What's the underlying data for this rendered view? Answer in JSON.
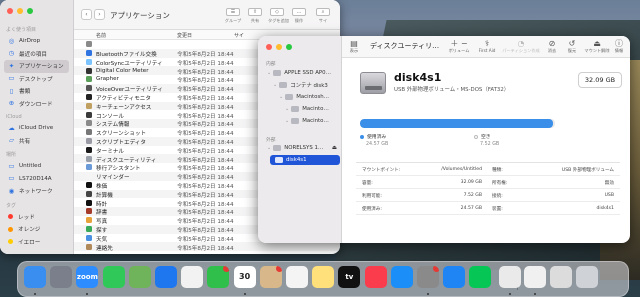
{
  "finder": {
    "title": "アプリケーション",
    "toolbar": {
      "group_label": "グループ",
      "share_label": "共有",
      "tags_label": "タグを追加",
      "action_label": "操作",
      "search_label": "サイ"
    },
    "columns": {
      "name": "名前",
      "date": "変更日",
      "size": "サイ"
    },
    "sidebar": {
      "favorites_heading": "よく使う項目",
      "favorites": [
        {
          "label": "AirDrop",
          "icon": "airdrop-icon"
        },
        {
          "label": "最近の項目",
          "icon": "clock-icon"
        },
        {
          "label": "アプリケーション",
          "icon": "apps-icon",
          "active": true
        },
        {
          "label": "デスクトップ",
          "icon": "desktop-icon"
        },
        {
          "label": "書類",
          "icon": "document-icon"
        },
        {
          "label": "ダウンロード",
          "icon": "download-icon"
        }
      ],
      "icloud_heading": "iCloud",
      "icloud": [
        {
          "label": "iCloud Drive",
          "icon": "cloud-icon"
        },
        {
          "label": "共有",
          "icon": "shared-folder-icon"
        }
      ],
      "locations_heading": "場所",
      "locations": [
        {
          "label": "Untitled",
          "icon": "drive-icon"
        },
        {
          "label": "LS720D14A",
          "icon": "monitor-icon"
        },
        {
          "label": "ネットワーク",
          "icon": "network-icon"
        }
      ],
      "tags_heading": "タグ",
      "tags": [
        {
          "label": "レッド",
          "color": "#ff3b30"
        },
        {
          "label": "オレンジ",
          "color": "#ff9500"
        },
        {
          "label": "イエロー",
          "color": "#ffcc00"
        }
      ]
    },
    "rows": [
      {
        "name": "",
        "date": "",
        "color": "#8a8a8a"
      },
      {
        "name": "Bluetoothファイル交換",
        "date": "令和5年8月2日 18:44",
        "color": "#2f74e0"
      },
      {
        "name": "ColorSyncユーティリティ",
        "date": "令和5年8月2日 18:44",
        "color": "#7cc4ff"
      },
      {
        "name": "Digital Color Meter",
        "date": "令和5年8月2日 18:44",
        "color": "#333333"
      },
      {
        "name": "Grapher",
        "date": "令和5年8月2日 18:44",
        "color": "#5aa05a"
      },
      {
        "name": "VoiceOverユーティリティ",
        "date": "令和5年8月2日 18:44",
        "color": "#555555"
      },
      {
        "name": "アクティビティモニタ",
        "date": "令和5年8月2日 18:44",
        "color": "#222222"
      },
      {
        "name": "キーチェーンアクセス",
        "date": "令和5年8月2日 18:44",
        "color": "#c0a060"
      },
      {
        "name": "コンソール",
        "date": "令和5年8月2日 18:44",
        "color": "#3b3b3b"
      },
      {
        "name": "システム情報",
        "date": "令和5年8月2日 18:44",
        "color": "#8a8a8a"
      },
      {
        "name": "スクリーンショット",
        "date": "令和5年8月2日 18:44",
        "color": "#777777"
      },
      {
        "name": "スクリプトエディタ",
        "date": "令和5年8月2日 18:44",
        "color": "#9a9aa5"
      },
      {
        "name": "ターミナル",
        "date": "令和5年8月2日 18:44",
        "color": "#1a1a1a"
      },
      {
        "name": "ディスクユーティリティ",
        "date": "令和5年8月2日 18:44",
        "color": "#9aa0aa"
      },
      {
        "name": "移行アシスタント",
        "date": "令和5年8月2日 18:44",
        "color": "#6a9ad8"
      },
      {
        "name": "リマインダー",
        "date": "令和5年8月2日 18:44",
        "color": "#f5f5f5"
      },
      {
        "name": "株価",
        "date": "令和5年8月2日 18:44",
        "color": "#111111"
      },
      {
        "name": "計算機",
        "date": "令和5年8月2日 18:44",
        "color": "#444444"
      },
      {
        "name": "時計",
        "date": "令和5年8月2日 18:44",
        "color": "#111111"
      },
      {
        "name": "辞書",
        "date": "令和5年8月2日 18:44",
        "color": "#a33a2a"
      },
      {
        "name": "写真",
        "date": "令和5年8月2日 18:44",
        "color": "#e8a23a"
      },
      {
        "name": "探す",
        "date": "令和5年8月2日 18:44",
        "color": "#3aaa5a"
      },
      {
        "name": "天気",
        "date": "令和5年8月2日 18:44",
        "color": "#4a90e2"
      },
      {
        "name": "連絡先",
        "date": "令和5年8月2日 18:44",
        "color": "#b08a5a"
      }
    ]
  },
  "disk_utility": {
    "title": "ディスクユーティリ…",
    "toolbar": {
      "view_label": "表示",
      "volume_label": "ボリューム",
      "first_aid_label": "First Aid",
      "partition_label": "パーティション作成",
      "erase_label": "消去",
      "restore_label": "復元",
      "unmount_label": "マウント解除",
      "info_label": "情報"
    },
    "sidebar": {
      "internal_heading": "内部",
      "external_heading": "外部",
      "items": [
        {
          "label": "APPLE SSD AP0…",
          "level": 0
        },
        {
          "label": "コンテナ disk3",
          "level": 1
        },
        {
          "label": "Macintosh…",
          "level": 2
        },
        {
          "label": "Macinto…",
          "level": 3
        },
        {
          "label": "Macinto…",
          "level": 3
        }
      ],
      "external": [
        {
          "label": "NORELSYS 1…",
          "level": 0,
          "eject": "⏏"
        },
        {
          "label": "disk4s1",
          "level": 1,
          "selected": true
        }
      ]
    },
    "disk": {
      "name": "disk4s1",
      "description": "USB 外部物理ボリューム・MS-DOS（FAT32）",
      "capacity": "32.09 GB",
      "used_fraction": 0.99,
      "used_label": "使用済み",
      "used_value": "24.57 GB",
      "free_label": "空き",
      "free_value": "7.52 GB",
      "used_color": "#3c8fe8",
      "free_color": "#e9e9e9"
    },
    "info": [
      {
        "k1": "マウントポイント:",
        "v1": "/Volumes/Untitled",
        "k2": "種類:",
        "v2": "USB 外部物理ボリューム"
      },
      {
        "k1": "容量:",
        "v1": "32.09 GB",
        "k2": "所有権:",
        "v2": "無効"
      },
      {
        "k1": "利用可能:",
        "v1": "7.52 GB",
        "k2": "接続:",
        "v2": "USB"
      },
      {
        "k1": "使用済み:",
        "v1": "24.57 GB",
        "k2": "装置:",
        "v2": "disk4s1"
      }
    ]
  },
  "dock": {
    "items": [
      {
        "name": "finder",
        "label": "",
        "color": "#3a8ef0",
        "running": true
      },
      {
        "name": "launchpad",
        "label": "",
        "color": "#7b7f8c"
      },
      {
        "name": "zoom",
        "label": "zoom",
        "color": "#2d8cff",
        "running": true
      },
      {
        "name": "messages",
        "label": "",
        "color": "#31c85a"
      },
      {
        "name": "maps",
        "label": "",
        "color": "#6fb35a"
      },
      {
        "name": "safari-compass",
        "label": "",
        "color": "#1f77f0"
      },
      {
        "name": "photos",
        "label": "",
        "color": "#f2f2f2"
      },
      {
        "name": "facetime",
        "label": "",
        "color": "#2fbf4a",
        "badge": ""
      },
      {
        "name": "calendar",
        "label": "30",
        "color": "#ffffff",
        "running": true
      },
      {
        "name": "contacts",
        "label": "",
        "color": "#d8b88a",
        "badge": ""
      },
      {
        "name": "reminders",
        "label": "",
        "color": "#f4f4f4"
      },
      {
        "name": "notes",
        "label": "",
        "color": "#ffe07a"
      },
      {
        "name": "tv",
        "label": "tv",
        "color": "#111111"
      },
      {
        "name": "music",
        "label": "",
        "color": "#fa3c4c"
      },
      {
        "name": "app-store",
        "label": "",
        "color": "#1c8ef7"
      },
      {
        "name": "system-settings",
        "label": "",
        "color": "#8a8a8a",
        "badge": "",
        "running": true
      },
      {
        "name": "safari",
        "label": "",
        "color": "#1f85f5"
      },
      {
        "name": "line",
        "label": "",
        "color": "#06c755"
      },
      {
        "name": "finder-2",
        "label": "",
        "color": "#eaeaea",
        "running": true
      },
      {
        "name": "preview",
        "label": "",
        "color": "#f0f0f0",
        "running": true
      },
      {
        "name": "disk-image",
        "label": "",
        "color": "#dcdcdc"
      },
      {
        "name": "trash",
        "label": "",
        "color": "#cfd3d8"
      }
    ]
  }
}
